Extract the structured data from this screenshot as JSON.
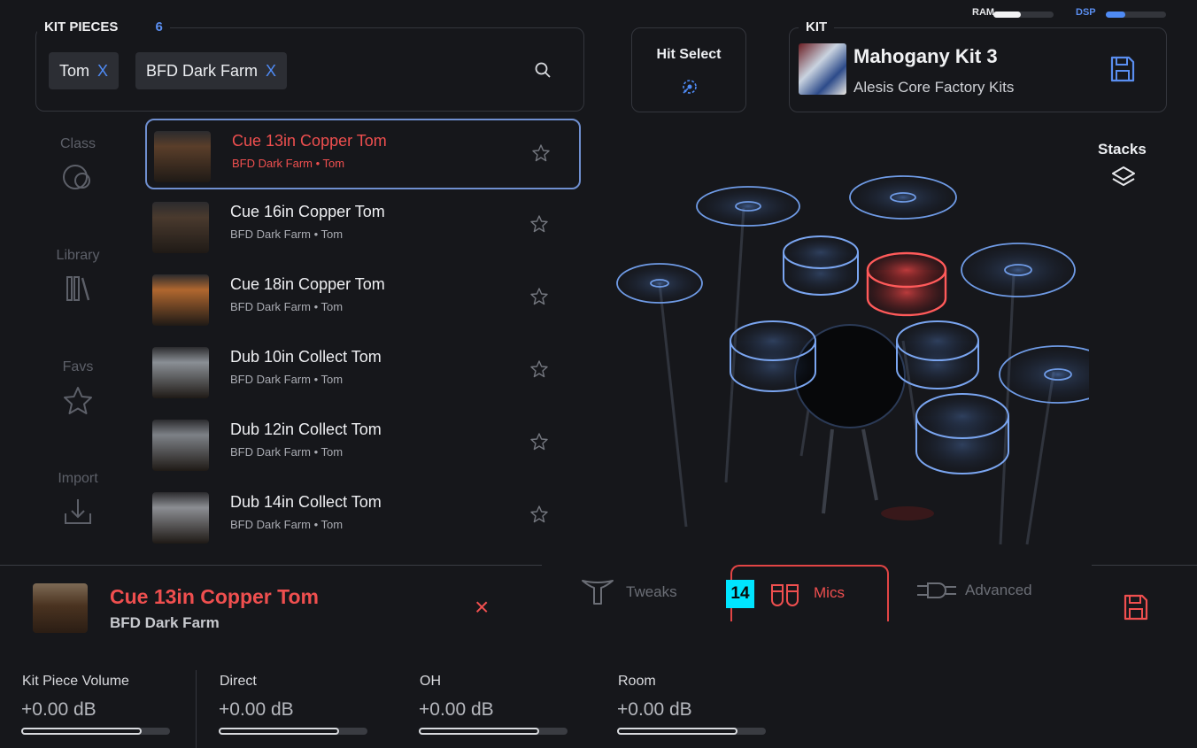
{
  "meters": {
    "ram_label": "RAM",
    "ram_level": 0.45,
    "dsp_label": "DSP",
    "dsp_level": 0.32
  },
  "kit_pieces": {
    "title": "KIT PIECES",
    "count": "6",
    "filters": [
      {
        "label": "Tom",
        "remove": "X"
      },
      {
        "label": "BFD Dark Farm",
        "remove": "X"
      }
    ]
  },
  "hit_select": {
    "label": "Hit Select"
  },
  "kit": {
    "legend": "KIT",
    "name": "Mahogany Kit 3",
    "library": "Alesis Core Factory Kits"
  },
  "stacks": {
    "label": "Stacks"
  },
  "sidebar": {
    "items": [
      {
        "label": "Class",
        "icon": "class-icon"
      },
      {
        "label": "Library",
        "icon": "library-icon"
      },
      {
        "label": "Favs",
        "icon": "star-icon"
      },
      {
        "label": "Import",
        "icon": "import-icon"
      }
    ]
  },
  "list": {
    "items": [
      {
        "name": "Cue 13in Copper Tom",
        "sub": "BFD Dark Farm • Tom",
        "selected": true,
        "thumb": "#5a3e2a"
      },
      {
        "name": "Cue 16in Copper Tom",
        "sub": "BFD Dark Farm • Tom",
        "selected": false,
        "thumb": "#4a3a2e"
      },
      {
        "name": "Cue 18in Copper Tom",
        "sub": "BFD Dark Farm • Tom",
        "selected": false,
        "thumb": "#b0672f"
      },
      {
        "name": "Dub 10in Collect Tom",
        "sub": "BFD Dark Farm • Tom",
        "selected": false,
        "thumb": "#8a8f95"
      },
      {
        "name": "Dub 12in Collect Tom",
        "sub": "BFD Dark Farm • Tom",
        "selected": false,
        "thumb": "#7d8187"
      },
      {
        "name": "Dub 14in Collect Tom",
        "sub": "BFD Dark Farm • Tom",
        "selected": false,
        "thumb": "#8c8e93"
      }
    ]
  },
  "selected_piece": {
    "name": "Cue 13in Copper Tom",
    "library": "BFD Dark Farm",
    "close": "×"
  },
  "tabs": [
    {
      "label": "Tweaks",
      "icon": "tweaks-icon",
      "active": false
    },
    {
      "label": "Mics",
      "icon": "mics-icon",
      "active": true,
      "badge": "14"
    },
    {
      "label": "Advanced",
      "icon": "advanced-icon",
      "active": false
    }
  ],
  "mixer": [
    {
      "label": "Kit Piece Volume",
      "value": "+0.00 dB",
      "level": 0.81
    },
    {
      "label": "Direct",
      "value": "+0.00 dB",
      "level": 0.81
    },
    {
      "label": "OH",
      "value": "+0.00 dB",
      "level": 0.81
    },
    {
      "label": "Room",
      "value": "+0.00 dB",
      "level": 0.81
    }
  ],
  "colors": {
    "accent_blue": "#4f8bf5",
    "accent_red": "#ef4f4f",
    "badge_cyan": "#00e5ff"
  }
}
